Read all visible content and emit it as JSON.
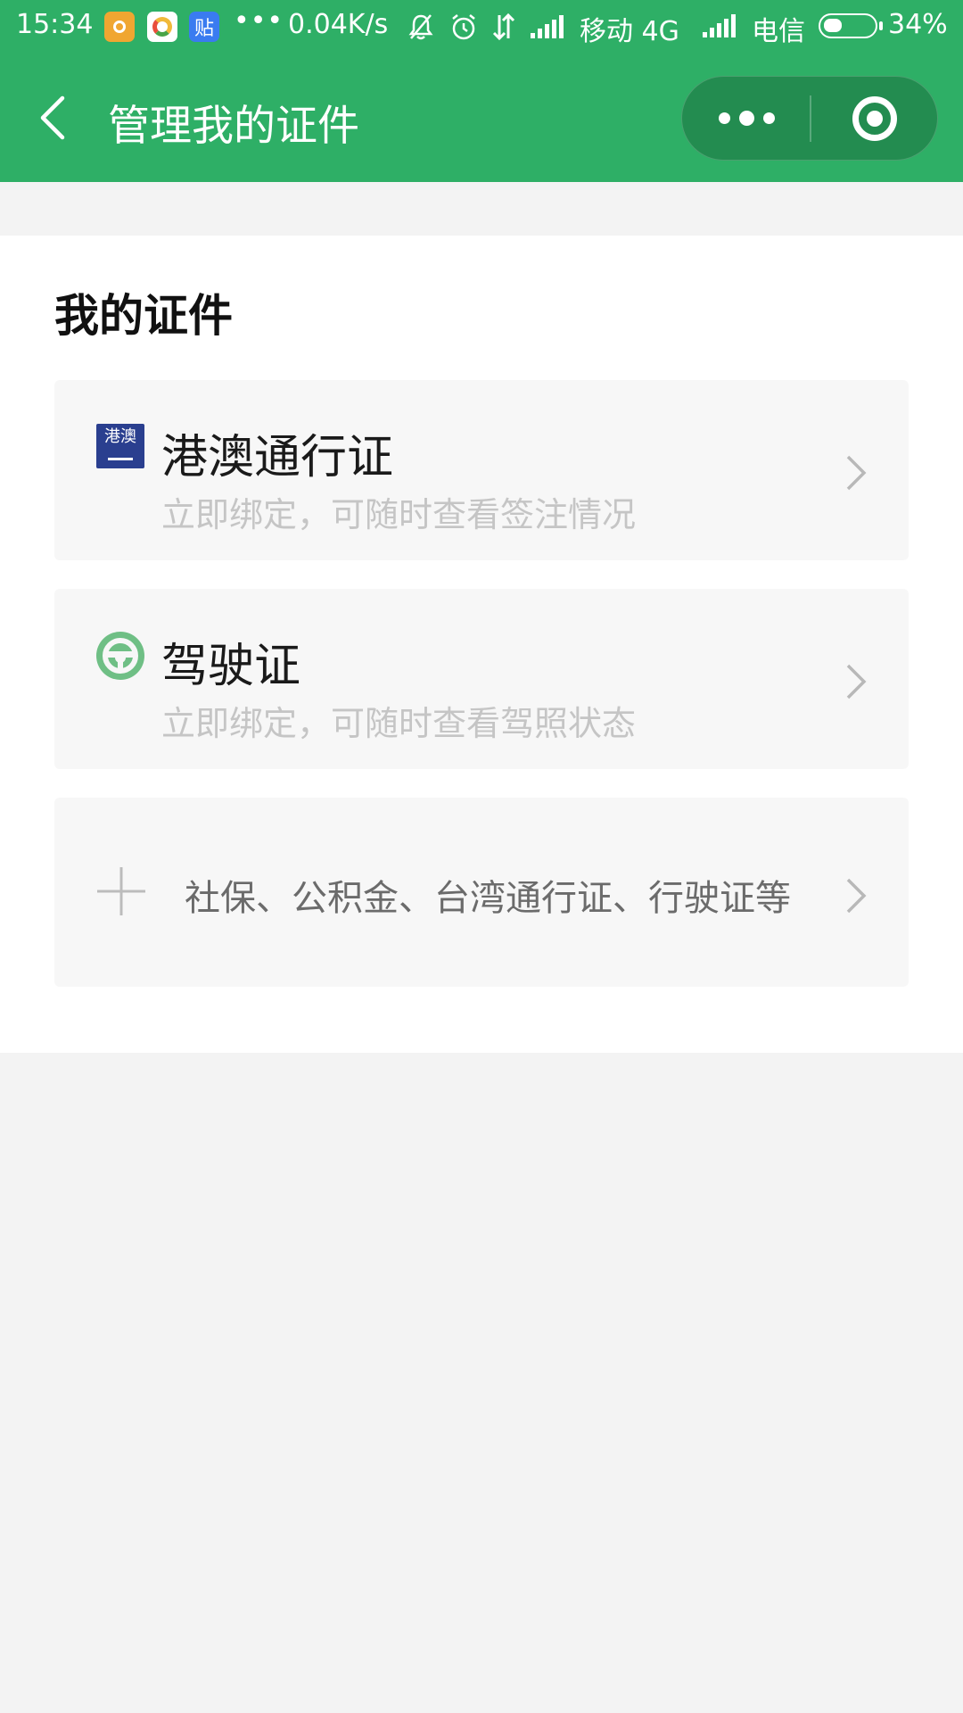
{
  "status_bar": {
    "time": "15:34",
    "notification_app_icons": [
      "chat-bubble-app-icon",
      "browser-app-icon",
      "tieba-app-icon"
    ],
    "tieba_icon_text": "贴",
    "more_indicator": "•••",
    "network_speed": "0.04K/s",
    "carrier_1": "移动 4G",
    "carrier_2": "电信",
    "battery_percent": "34%",
    "battery_level": 0.34
  },
  "nav_bar": {
    "title": "管理我的证件",
    "more_icon": "more-dots-icon",
    "close_icon": "target-close-icon"
  },
  "main": {
    "section_title": "我的证件",
    "items": [
      {
        "icon": "hk-macau-permit-icon",
        "icon_text": "港澳",
        "label": "港澳通行证",
        "subtitle": "立即绑定，可随时查看签注情况"
      },
      {
        "icon": "steering-wheel-icon",
        "label": "驾驶证",
        "subtitle": "立即绑定，可随时查看驾照状态"
      },
      {
        "icon": "plus-icon",
        "label": "社保、公积金、台湾通行证、行驶证等"
      }
    ]
  },
  "colors": {
    "header_green": "#2eaf66",
    "capsule_green": "#238c50",
    "page_background": "#f3f3f3",
    "card_background": "#f7f7f7",
    "permit_icon_blue": "#2a3f8f",
    "wheel_icon_green": "#6fbf85"
  }
}
